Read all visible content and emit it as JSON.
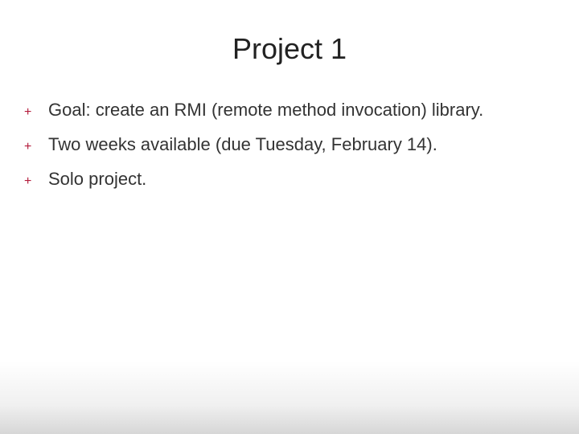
{
  "slide": {
    "title": "Project 1",
    "bullets": [
      {
        "marker": "+",
        "text": "Goal: create an RMI (remote method invocation) library."
      },
      {
        "marker": "+",
        "text": "Two weeks available (due Tuesday, February 14)."
      },
      {
        "marker": "+",
        "text": "Solo project."
      }
    ]
  }
}
